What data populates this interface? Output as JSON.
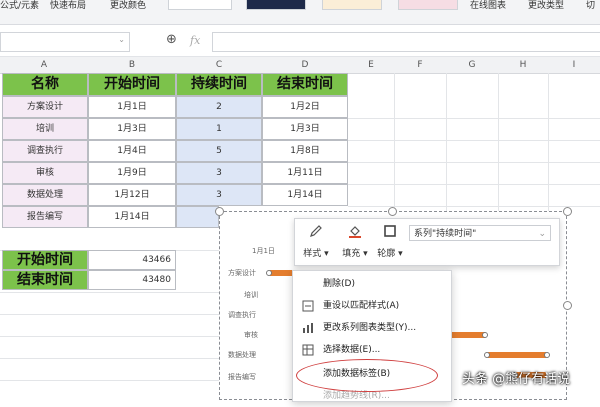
{
  "ribbon": {
    "items": [
      "公式/元素",
      "快速布局",
      "更改颜色",
      "在线图表",
      "更改类型",
      "切"
    ]
  },
  "formula_bar": {
    "fx_label": "fx"
  },
  "columns": [
    "A",
    "B",
    "C",
    "D",
    "E",
    "F",
    "G",
    "H",
    "I"
  ],
  "table": {
    "headers": [
      "名称",
      "开始时间",
      "持续时间",
      "结束时间"
    ],
    "rows": [
      {
        "name": "方案设计",
        "start": "1月1日",
        "duration": "2",
        "end": "1月2日"
      },
      {
        "name": "培训",
        "start": "1月3日",
        "duration": "1",
        "end": "1月3日"
      },
      {
        "name": "调查执行",
        "start": "1月4日",
        "duration": "5",
        "end": "1月8日"
      },
      {
        "name": "审核",
        "start": "1月9日",
        "duration": "3",
        "end": "1月11日"
      },
      {
        "name": "数据处理",
        "start": "1月12日",
        "duration": "3",
        "end": "1月14日"
      },
      {
        "name": "报告编写",
        "start": "1月14日",
        "duration": "",
        "end": ""
      }
    ]
  },
  "summary": [
    {
      "label": "开始时间",
      "value": "43466"
    },
    {
      "label": "结束时间",
      "value": "43480"
    }
  ],
  "chart": {
    "x_tick": "1月1日",
    "y_labels": [
      "方案设计",
      "培训",
      "调查执行",
      "审核",
      "数据处理",
      "报告编写"
    ],
    "bar_color": "#e47d2e"
  },
  "toolbar": {
    "style_label": "样式",
    "fill_label": "填充",
    "outline_label": "轮廓",
    "series_select": "系列\"持续时间\""
  },
  "context_menu": {
    "items": [
      "删除(D)",
      "重设以匹配样式(A)",
      "更改系列图表类型(Y)...",
      "选择数据(E)...",
      "添加数据标签(B)",
      "添加趋势线(R)..."
    ]
  },
  "watermark": "头条 @熊仔有话说"
}
